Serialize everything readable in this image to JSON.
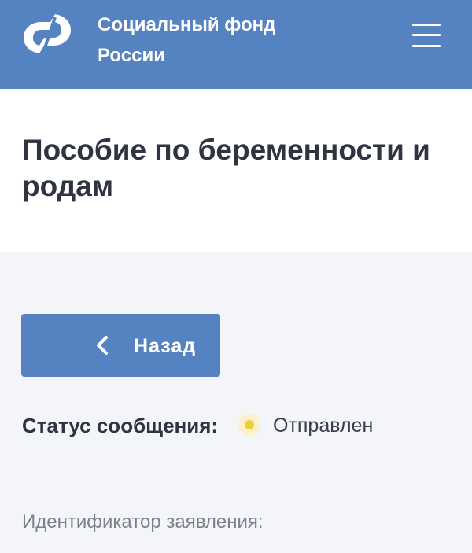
{
  "header": {
    "brand_line1": "Социальный фонд",
    "brand_line2": "России",
    "logo_icon": "sfr-logo-icon",
    "menu_icon": "burger-menu-icon"
  },
  "page": {
    "title": "Пособие по беременности и родам"
  },
  "back_button": {
    "label": "Назад",
    "icon": "chevron-left-icon"
  },
  "status": {
    "label": "Статус сообщения:",
    "value": "Отправлен",
    "indicator_color": "#f2cc3a"
  },
  "fields": {
    "application_id_label": "Идентификатор заявления:"
  },
  "colors": {
    "brand_blue": "#5582c0",
    "background": "#f3f5f9",
    "text_dark": "#2f3441"
  }
}
